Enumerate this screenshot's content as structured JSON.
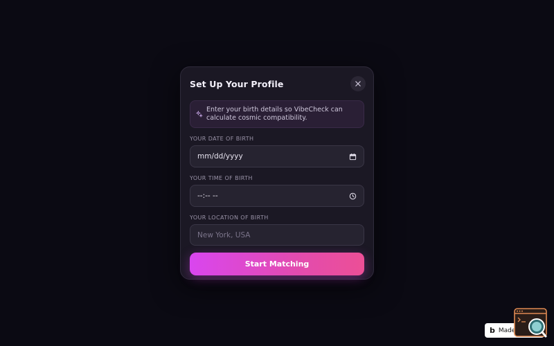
{
  "modal": {
    "title": "Set Up Your Profile",
    "close_icon": "close-icon",
    "info": {
      "icon": "sparkles-icon",
      "text": "Enter your birth details so VibeCheck can calculate cosmic compatibility."
    },
    "fields": {
      "date": {
        "label": "YOUR DATE OF BIRTH",
        "value": "mm/dd/yyyy",
        "icon": "calendar-icon"
      },
      "time": {
        "label": "YOUR TIME OF BIRTH",
        "value": "--:-- --",
        "icon": "clock-icon"
      },
      "location": {
        "label": "YOUR LOCATION OF BIRTH",
        "placeholder": "New York, USA"
      }
    },
    "submit_label": "Start Matching"
  },
  "badge": {
    "logo": "b",
    "text": "Made in B"
  },
  "colors": {
    "background": "#0b0a13",
    "modal": "#1b1824",
    "accent_start": "#d946ef",
    "accent_end": "#ec4f96"
  }
}
